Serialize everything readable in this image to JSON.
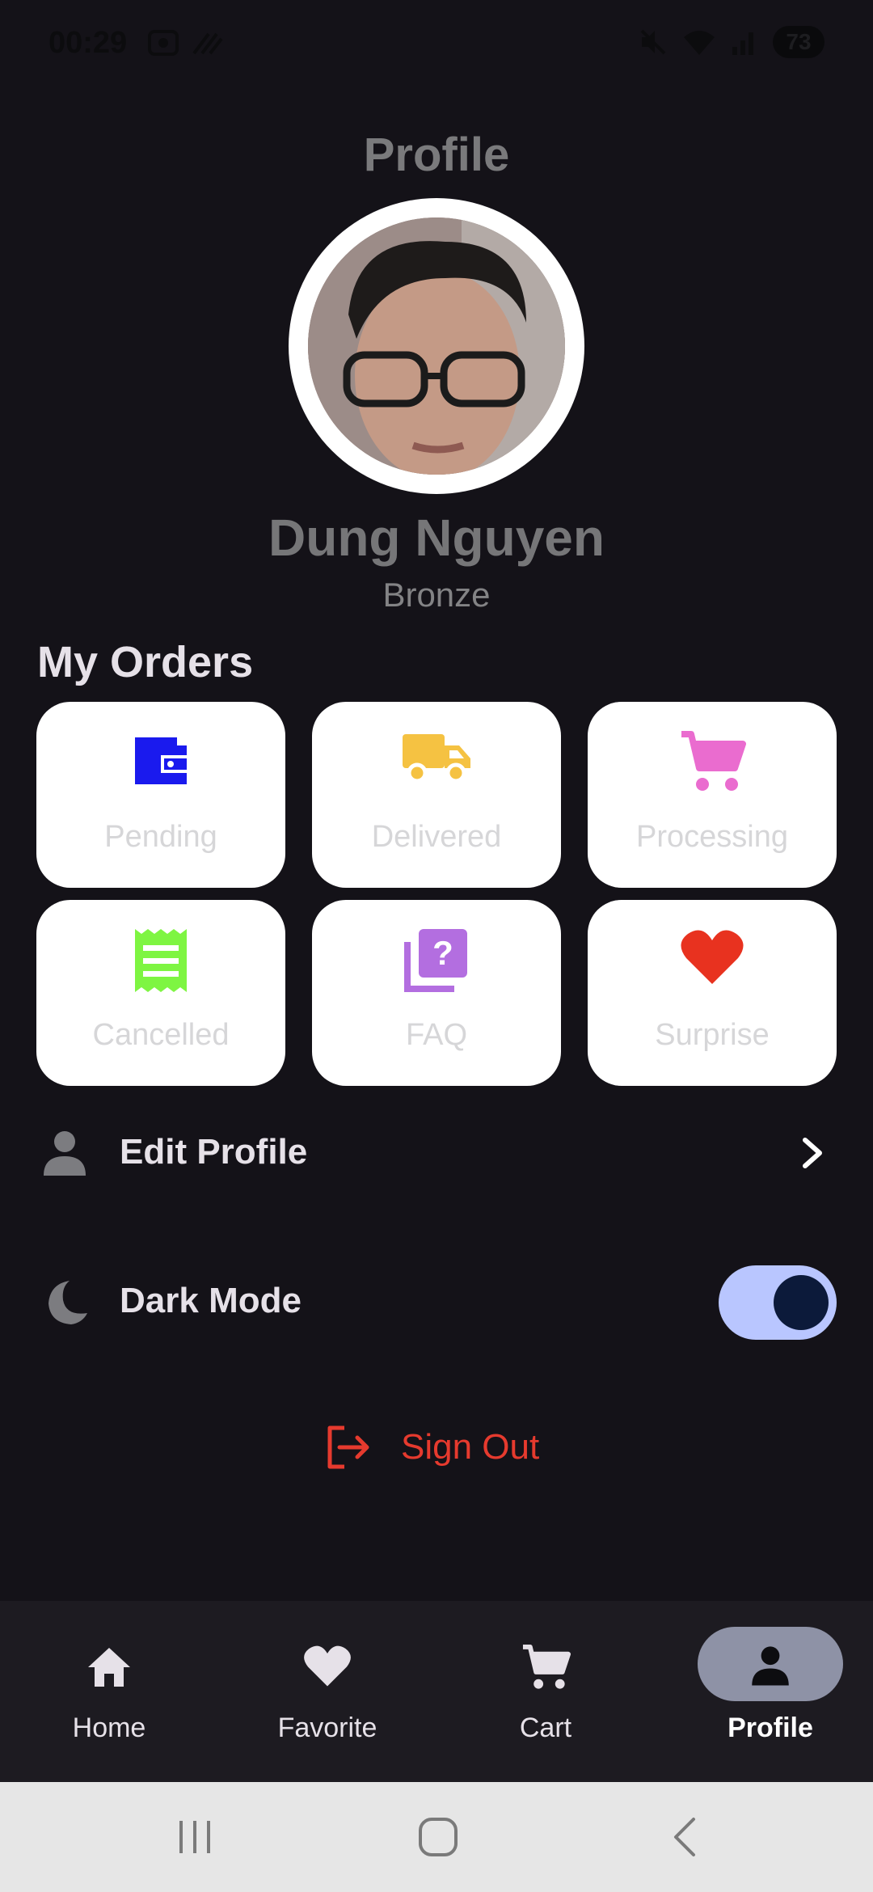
{
  "status_bar": {
    "time": "00:29",
    "battery": "73"
  },
  "header": {
    "title": "Profile"
  },
  "profile": {
    "name": "Dung Nguyen",
    "tier": "Bronze"
  },
  "orders": {
    "title": "My Orders",
    "items": [
      {
        "label": "Pending",
        "icon": "wallet-icon",
        "color": "#1a1aee"
      },
      {
        "label": "Delivered",
        "icon": "truck-icon",
        "color": "#f5c242"
      },
      {
        "label": "Processing",
        "icon": "cart-icon",
        "color": "#ea6ccf"
      },
      {
        "label": "Cancelled",
        "icon": "receipt-icon",
        "color": "#7ef542"
      },
      {
        "label": "FAQ",
        "icon": "question-icon",
        "color": "#b36ee0"
      },
      {
        "label": "Surprise",
        "icon": "heart-icon",
        "color": "#e8321f"
      }
    ]
  },
  "menu": {
    "edit_profile": "Edit Profile",
    "dark_mode": "Dark Mode",
    "dark_mode_on": true,
    "sign_out": "Sign Out"
  },
  "bottom_nav": {
    "items": [
      {
        "label": "Home",
        "icon": "home-icon"
      },
      {
        "label": "Favorite",
        "icon": "heart-icon"
      },
      {
        "label": "Cart",
        "icon": "cart-icon"
      },
      {
        "label": "Profile",
        "icon": "person-icon",
        "active": true
      }
    ]
  },
  "colors": {
    "background": "#141218",
    "card": "#ffffff",
    "accent_toggle": "#b9c6ff",
    "sign_out": "#e63a2e",
    "nav_active_pill": "#8e92a6"
  }
}
